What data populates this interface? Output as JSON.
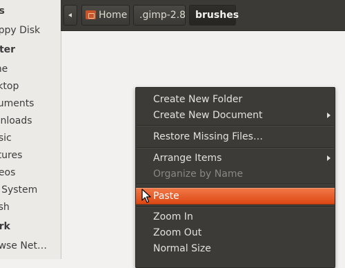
{
  "sidebar": {
    "devices_header": "es",
    "floppy": "oppy Disk",
    "computer_header": "uter",
    "items": [
      "me",
      "sktop",
      "cuments",
      "wnloads",
      "usic",
      "ctures",
      "deos",
      "e System",
      "ash"
    ],
    "network_header": "ork",
    "browse_network": "owse Net…"
  },
  "toolbar": {
    "back_icon": "chevron-left-icon",
    "crumbs": [
      "Home",
      ".gimp-2.8",
      "brushes"
    ]
  },
  "context_menu": {
    "items": [
      {
        "label": "Create New Folder"
      },
      {
        "label": "Create New Document"
      },
      {
        "label": "Restore Missing Files…"
      },
      {
        "label": "Arrange Items"
      },
      {
        "label": "Organize by Name"
      },
      {
        "label": "Paste"
      },
      {
        "label": "Zoom In"
      },
      {
        "label": "Zoom Out"
      },
      {
        "label": "Normal Size"
      }
    ]
  },
  "colors": {
    "accent": "#dd4814",
    "toolbar_bg": "#3b3a36",
    "menu_bg": "#3c3b37",
    "sidebar_bg": "#eceae7"
  }
}
